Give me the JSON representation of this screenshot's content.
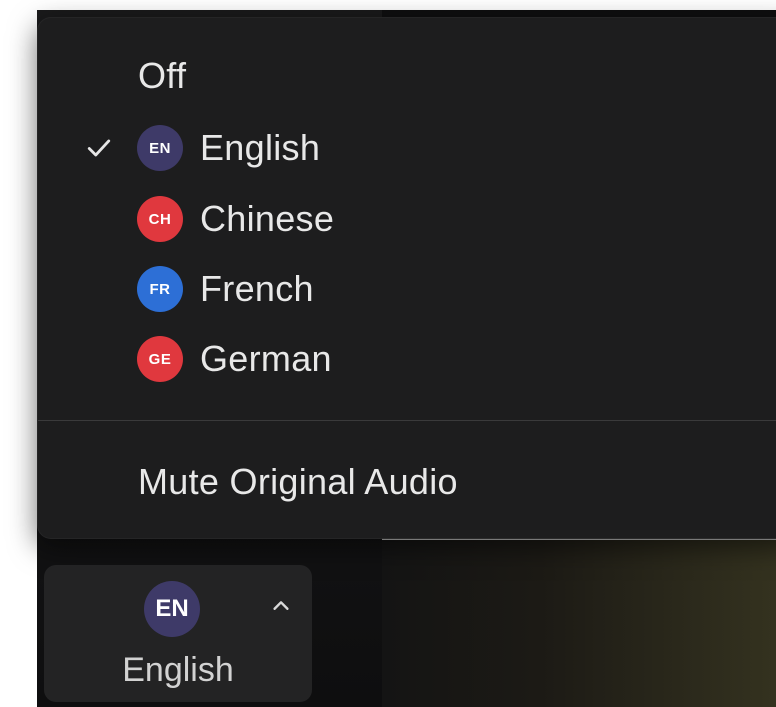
{
  "menu": {
    "off_label": "Off",
    "languages": [
      {
        "code": "EN",
        "label": "English",
        "color": "#3e3a68",
        "selected": true
      },
      {
        "code": "CH",
        "label": "Chinese",
        "color": "#e0383e",
        "selected": false
      },
      {
        "code": "FR",
        "label": "French",
        "color": "#2d6fd6",
        "selected": false
      },
      {
        "code": "GE",
        "label": "German",
        "color": "#e0383e",
        "selected": false
      }
    ],
    "mute_label": "Mute Original Audio"
  },
  "control": {
    "badge": "EN",
    "label": "English",
    "caret_icon": "chevron-up-icon"
  }
}
